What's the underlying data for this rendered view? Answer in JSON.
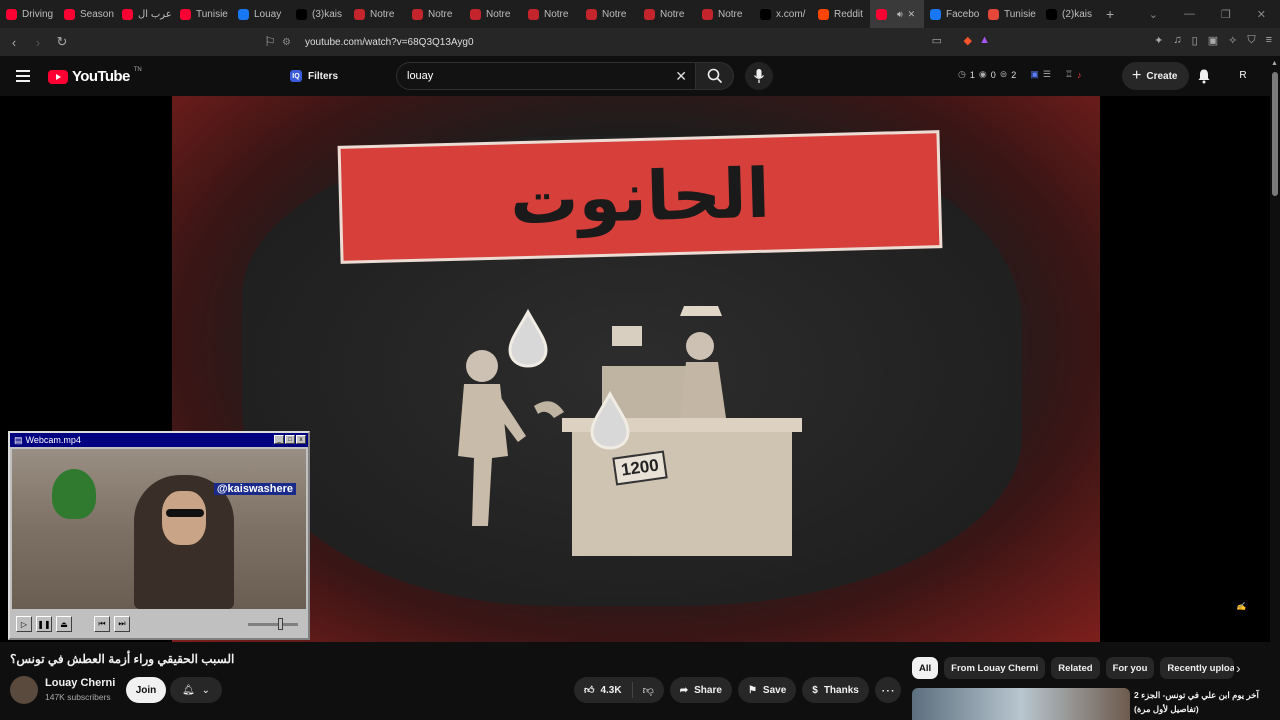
{
  "browser": {
    "tabs": [
      {
        "label": "Driving",
        "color": "#ff0033"
      },
      {
        "label": "Season",
        "color": "#ff0033"
      },
      {
        "label": "عرب ال",
        "color": "#ff0033"
      },
      {
        "label": "Tunisie",
        "color": "#ff0033"
      },
      {
        "label": "Louay",
        "color": "#1877f2"
      },
      {
        "label": "(3)kais",
        "color": "#000000"
      },
      {
        "label": "Notre",
        "color": "#c4242b"
      },
      {
        "label": "Notre",
        "color": "#c4242b"
      },
      {
        "label": "Notre",
        "color": "#c4242b"
      },
      {
        "label": "Notre",
        "color": "#c4242b"
      },
      {
        "label": "Notre",
        "color": "#c4242b"
      },
      {
        "label": "Notre",
        "color": "#c4242b"
      },
      {
        "label": "Notre",
        "color": "#c4242b"
      },
      {
        "label": "x.com/",
        "color": "#000000"
      },
      {
        "label": "Reddit",
        "color": "#ff4500"
      },
      {
        "label": "",
        "color": "#ff0033",
        "active": true
      },
      {
        "label": "Facebo",
        "color": "#1877f2"
      },
      {
        "label": "Tunisie",
        "color": "#e4463a"
      },
      {
        "label": "(2)kais",
        "color": "#000000"
      }
    ],
    "url": "youtube.com/watch?v=68Q3Q13Ayg0"
  },
  "header": {
    "logo_text": "YouTube",
    "logo_sup": "TN",
    "filters_label": "Filters",
    "search_value": "louay",
    "stats": [
      "1",
      "0",
      "2"
    ],
    "create_label": "Create",
    "avatar_letter": "R"
  },
  "thumbnail": {
    "banner_text": "الحانوت",
    "price_text": "1200",
    "watermark": "kaiswashere"
  },
  "webcam": {
    "title": "Webcam.mp4",
    "handle": "@kaiswashere"
  },
  "video": {
    "title": "السبب الحقيقي وراء أزمة العطش في تونس؟",
    "channel_name": "Louay Cherni",
    "subscribers": "147K subscribers",
    "join_label": "Join",
    "likes": "4.3K",
    "share_label": "Share",
    "save_label": "Save",
    "thanks_label": "Thanks"
  },
  "sidebar": {
    "chips": [
      "All",
      "From Louay Cherni",
      "Related",
      "For you",
      "Recently uploaded"
    ],
    "rec_title": "آخر يوم ابن علي في تونس- الجزء 2 (تفاصيل لأول مرة)"
  },
  "colors": {
    "accent": "#ff0033",
    "background": "#0f0f0f",
    "chip_bg": "#272727"
  }
}
